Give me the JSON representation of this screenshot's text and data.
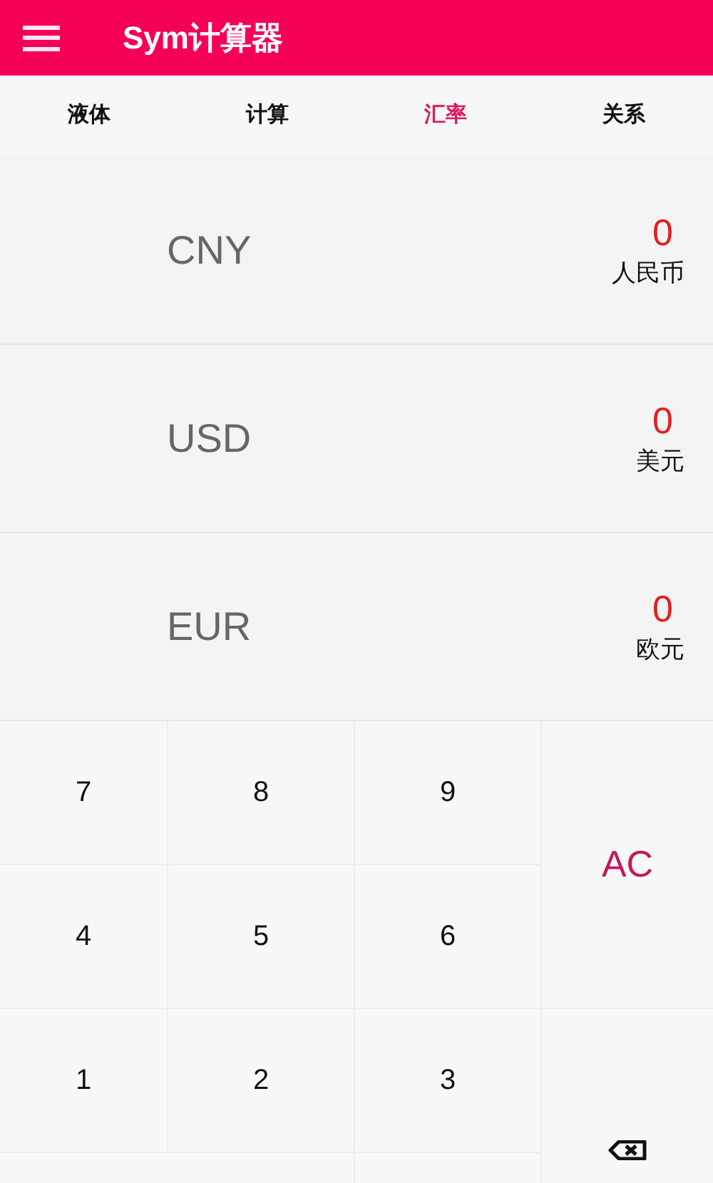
{
  "app_bar": {
    "title": "Sym计算器"
  },
  "tabs": [
    {
      "label": "液体",
      "selected": false
    },
    {
      "label": "计算",
      "selected": false
    },
    {
      "label": "汇率",
      "selected": true
    },
    {
      "label": "关系",
      "selected": false
    }
  ],
  "currencies": [
    {
      "code": "CNY",
      "value": "0",
      "name": "人民币"
    },
    {
      "code": "USD",
      "value": "0",
      "name": "美元"
    },
    {
      "code": "EUR",
      "value": "0",
      "name": "欧元"
    }
  ],
  "keypad": [
    {
      "kind": "digit",
      "label": "7"
    },
    {
      "kind": "digit",
      "label": "8"
    },
    {
      "kind": "digit",
      "label": "9"
    },
    {
      "kind": "clear",
      "label": "AC"
    },
    {
      "kind": "digit",
      "label": "4"
    },
    {
      "kind": "digit",
      "label": "5"
    },
    {
      "kind": "digit",
      "label": "6"
    },
    {
      "kind": "digit",
      "label": "1"
    },
    {
      "kind": "digit",
      "label": "2"
    },
    {
      "kind": "digit",
      "label": "3"
    },
    {
      "kind": "backspace"
    }
  ]
}
